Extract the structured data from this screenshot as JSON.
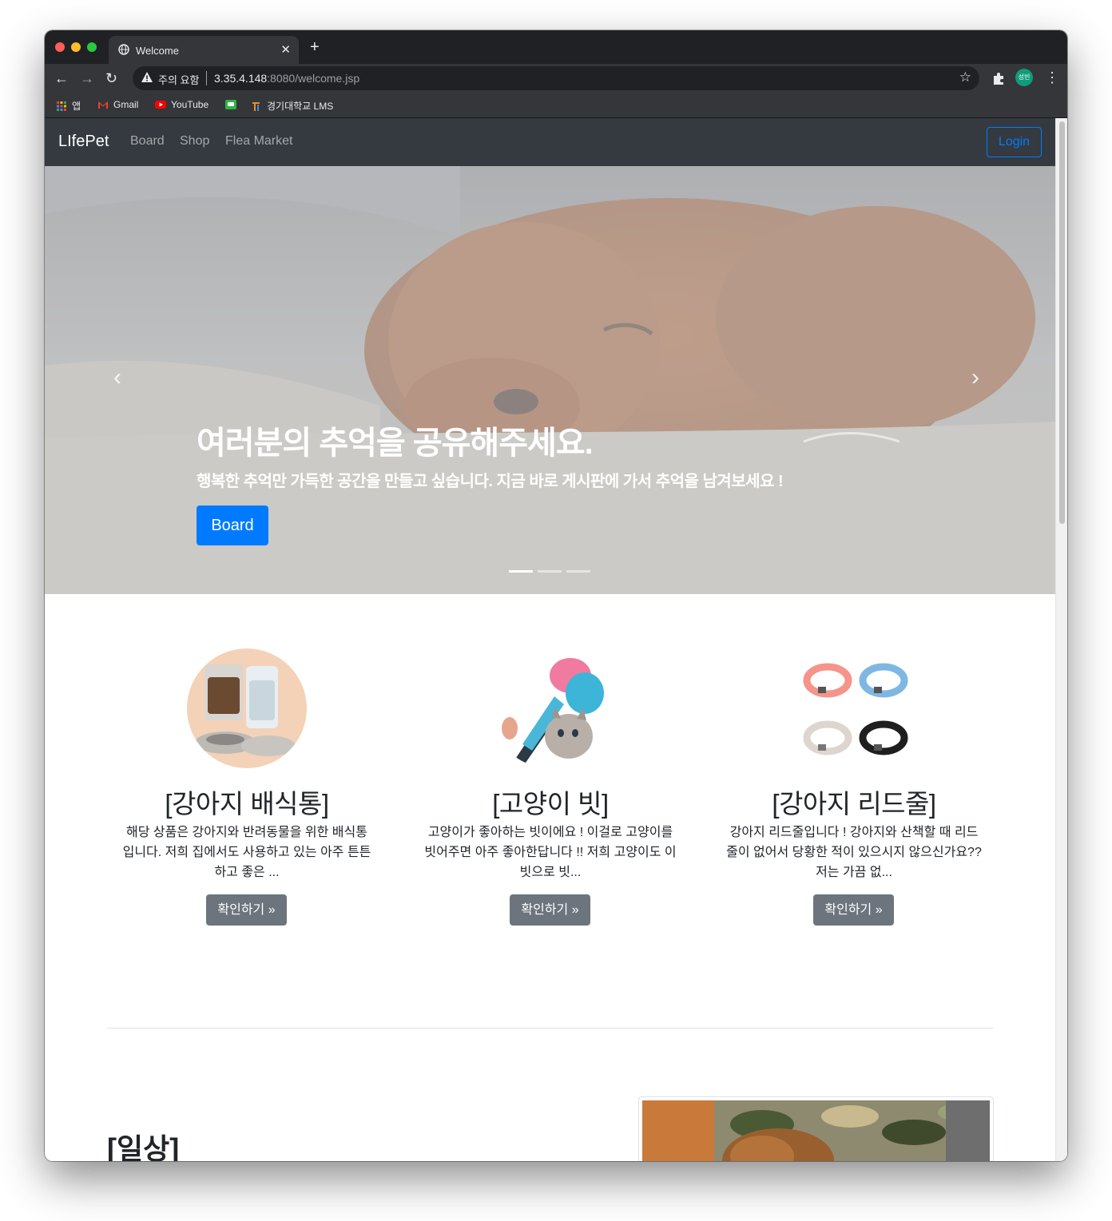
{
  "browser": {
    "tab_title": "Welcome",
    "security_text": "주의 요함",
    "url_host": "3.35.4.148",
    "url_rest": ":8080/welcome.jsp",
    "profile_initials": "성빈",
    "bookmarks": [
      "앱",
      "Gmail",
      "YouTube",
      "경기대학교 LMS"
    ]
  },
  "navbar": {
    "brand": "LIfePet",
    "links": [
      "Board",
      "Shop",
      "Flea Market"
    ],
    "login": "Login"
  },
  "hero": {
    "title": "여러분의 추억을 공유해주세요.",
    "subtitle": "행복한 추억만 가득한 공간을 만들고 싶습니다. 지금 바로 게시판에 가서 추억을 남겨보세요 !",
    "button": "Board",
    "slides": 3,
    "active_slide": 1
  },
  "products": [
    {
      "title": "[강아지 배식통]",
      "desc": "해당 상품은 강아지와 반려동물을 위한 배식통 입니다. 저희 집에서도 사용하고 있는 아주 튼튼하고 좋은 ...",
      "button": "확인하기 »"
    },
    {
      "title": "[고양이 빗]",
      "desc": "고양이가 좋아하는 빗이에요 ! 이걸로 고양이를 빗어주면 아주 좋아한답니다 !! 저희 고양이도 이 빗으로 빗...",
      "button": "확인하기 »"
    },
    {
      "title": "[강아지 리드줄]",
      "desc": "강아지 리드줄입니다 ! 강아지와 산책할 때 리드줄이 없어서 당황한 적이 있으시지 않으신가요?? 저는 가끔 없...",
      "button": "확인하기 »"
    }
  ],
  "section": {
    "title": "[일상]"
  },
  "colors": {
    "primary": "#007bff",
    "navbar": "#343a40",
    "secondary": "#6c757d"
  }
}
